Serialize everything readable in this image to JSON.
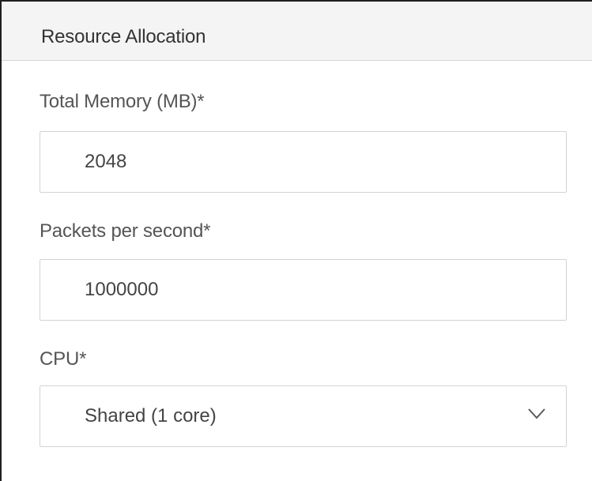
{
  "panel": {
    "title": "Resource Allocation"
  },
  "fields": {
    "memory": {
      "label": "Total Memory (MB)*",
      "value": "2048"
    },
    "packets": {
      "label": "Packets per second*",
      "value": "1000000"
    },
    "cpu": {
      "label": "CPU*",
      "selected": "Shared (1 core)",
      "icon": "chevron-down-icon"
    }
  },
  "colors": {
    "header_background": "#f4f4f4",
    "input_border": "#d3d3d3",
    "label_text": "#555555",
    "value_text": "#444444"
  }
}
